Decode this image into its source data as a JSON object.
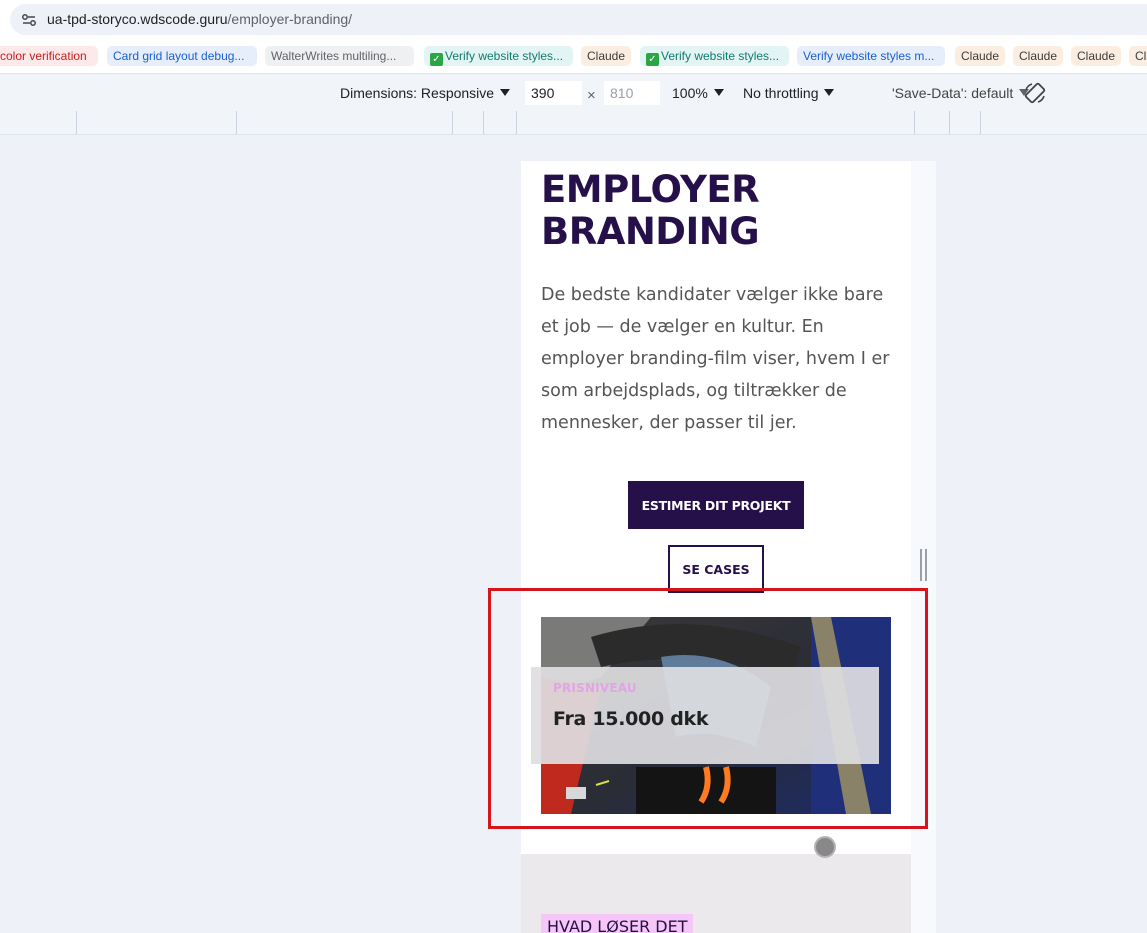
{
  "browser": {
    "url_host": "ua-tpd-storyco.wdscode.guru",
    "url_path": "/employer-branding/"
  },
  "bookmarks": [
    {
      "label": "color verification",
      "style": "red"
    },
    {
      "label": "Card grid layout debug...",
      "style": "blue"
    },
    {
      "label": "WalterWrites multiling...",
      "style": "gray"
    },
    {
      "label": "Verify website styles...",
      "style": "teal",
      "check": true
    },
    {
      "label": "Claude",
      "style": "orange"
    },
    {
      "label": "Verify website styles...",
      "style": "teal",
      "check": true
    },
    {
      "label": "Verify website styles m...",
      "style": "blue"
    },
    {
      "label": "Claude",
      "style": "orange"
    },
    {
      "label": "Claude",
      "style": "orange"
    },
    {
      "label": "Claude",
      "style": "orange"
    },
    {
      "label": "Cla",
      "style": "orange"
    }
  ],
  "device_toolbar": {
    "dimensions_label": "Dimensions: Responsive",
    "width_value": "390",
    "times": "×",
    "height_placeholder": "810",
    "zoom": "100%",
    "throttling": "No throttling",
    "save_data": "'Save-Data': default"
  },
  "page": {
    "hero_title": "EMPLOYER BRANDING",
    "hero_text": "De bedste kandidater vælger ikke bare et job — de vælger en kultur. En employer branding-film viser, hvem I er som arbejdsplads, og tiltrækker de mennesker, der passer til jer.",
    "primary_button": "ESTIMER DIT PROJEKT",
    "secondary_button": "SE CASES",
    "price_label": "PRISNIVEAU",
    "price_value": "Fra 15.000 dkk",
    "section_tag": "HVAD LØSER DET"
  },
  "colors": {
    "brand_dark": "#25104a",
    "price_label": "#e2a4e6",
    "tag_bg": "#f6c6f6",
    "highlight": "#d4151b"
  }
}
